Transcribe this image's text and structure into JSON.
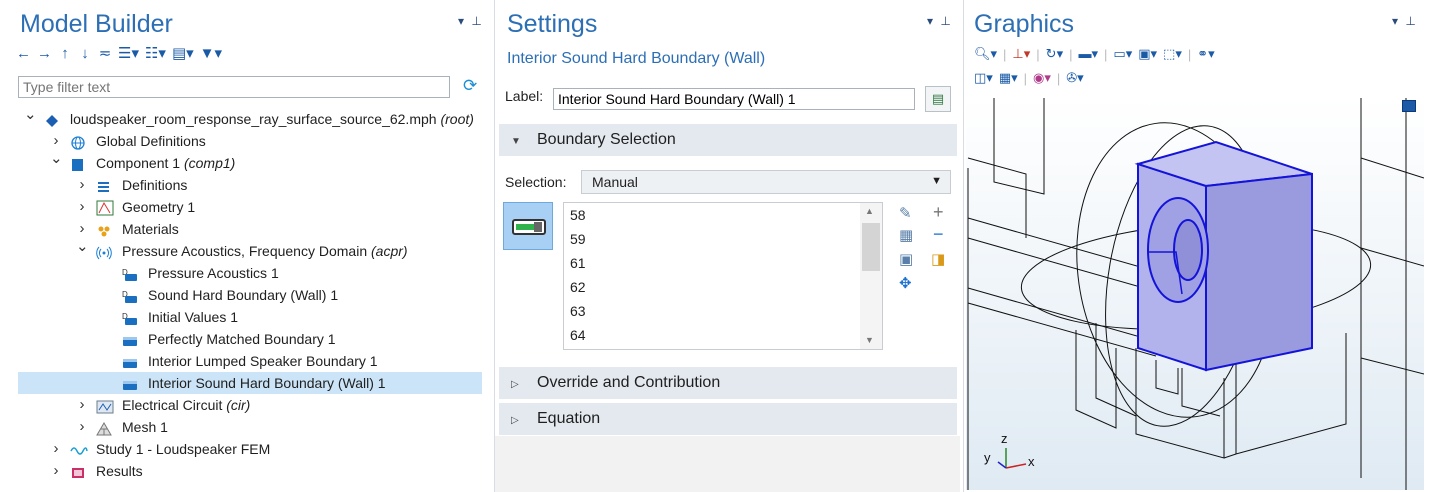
{
  "model_builder": {
    "title": "Model Builder",
    "pin": "▾ ⊥",
    "toolbar": [
      "←",
      "→",
      "↑",
      "↓",
      "≂",
      "☰▾",
      "☷▾",
      "▤▾",
      "▼▾"
    ],
    "filter_placeholder": "Type filter text",
    "refresh": "⟳",
    "tree": [
      {
        "label": "loudspeaker_room_response_ray_surface_source_62.mph",
        "tag": "(root)",
        "indent": 0,
        "twisty": "expanded",
        "icon": "file-icon",
        "selected": false
      },
      {
        "label": "Global Definitions",
        "tag": "",
        "indent": 1,
        "twisty": "collapsed",
        "icon": "globe-icon",
        "selected": false
      },
      {
        "label": "Component 1",
        "tag": "(comp1)",
        "indent": 1,
        "twisty": "expanded",
        "icon": "component-icon",
        "selected": false
      },
      {
        "label": "Definitions",
        "tag": "",
        "indent": 2,
        "twisty": "collapsed",
        "icon": "definitions-icon",
        "selected": false
      },
      {
        "label": "Geometry 1",
        "tag": "",
        "indent": 2,
        "twisty": "collapsed",
        "icon": "geometry-icon",
        "selected": false
      },
      {
        "label": "Materials",
        "tag": "",
        "indent": 2,
        "twisty": "collapsed",
        "icon": "materials-icon",
        "selected": false
      },
      {
        "label": "Pressure Acoustics, Frequency Domain",
        "tag": "(acpr)",
        "indent": 2,
        "twisty": "expanded",
        "icon": "acoustics-icon",
        "selected": false
      },
      {
        "label": "Pressure Acoustics 1",
        "tag": "",
        "indent": 3,
        "twisty": "none",
        "icon": "domain-node-icon",
        "selected": false
      },
      {
        "label": "Sound Hard Boundary (Wall) 1",
        "tag": "",
        "indent": 3,
        "twisty": "none",
        "icon": "domain-node-icon",
        "selected": false
      },
      {
        "label": "Initial Values 1",
        "tag": "",
        "indent": 3,
        "twisty": "none",
        "icon": "domain-node-icon",
        "selected": false
      },
      {
        "label": "Perfectly Matched Boundary 1",
        "tag": "",
        "indent": 3,
        "twisty": "none",
        "icon": "boundary-node-icon",
        "selected": false
      },
      {
        "label": "Interior Lumped Speaker Boundary 1",
        "tag": "",
        "indent": 3,
        "twisty": "none",
        "icon": "boundary-node-icon",
        "selected": false
      },
      {
        "label": "Interior Sound Hard Boundary (Wall) 1",
        "tag": "",
        "indent": 3,
        "twisty": "none",
        "icon": "boundary-node-icon",
        "selected": true
      },
      {
        "label": "Electrical Circuit",
        "tag": "(cir)",
        "indent": 2,
        "twisty": "collapsed",
        "icon": "circuit-icon",
        "selected": false
      },
      {
        "label": "Mesh 1",
        "tag": "",
        "indent": 2,
        "twisty": "collapsed",
        "icon": "mesh-icon",
        "selected": false
      },
      {
        "label": "Study 1 - Loudspeaker FEM",
        "tag": "",
        "indent": 1,
        "twisty": "collapsed",
        "icon": "study-icon",
        "selected": false
      },
      {
        "label": "Results",
        "tag": "",
        "indent": 1,
        "twisty": "collapsed",
        "icon": "results-icon",
        "selected": false
      }
    ]
  },
  "settings": {
    "title": "Settings",
    "pin": "▾ ⊥",
    "subtitle": "Interior Sound Hard Boundary (Wall)",
    "label_caption": "Label:",
    "label_value": "Interior Sound Hard Boundary (Wall) 1",
    "sections": {
      "boundary_selection": "Boundary Selection",
      "override": "Override and Contribution",
      "equation": "Equation"
    },
    "selection_caption": "Selection:",
    "selection_value": "Manual",
    "boundaries": [
      "58",
      "59",
      "61",
      "62",
      "63",
      "64"
    ]
  },
  "graphics": {
    "title": "Graphics",
    "pin": "▾ ⊥",
    "axis_labels": {
      "z": "z",
      "y": "y",
      "x": "x"
    },
    "colors": {
      "selection_fill": "#a6a6e6",
      "selection_edge": "#1414d8",
      "wire": "#111111"
    }
  }
}
